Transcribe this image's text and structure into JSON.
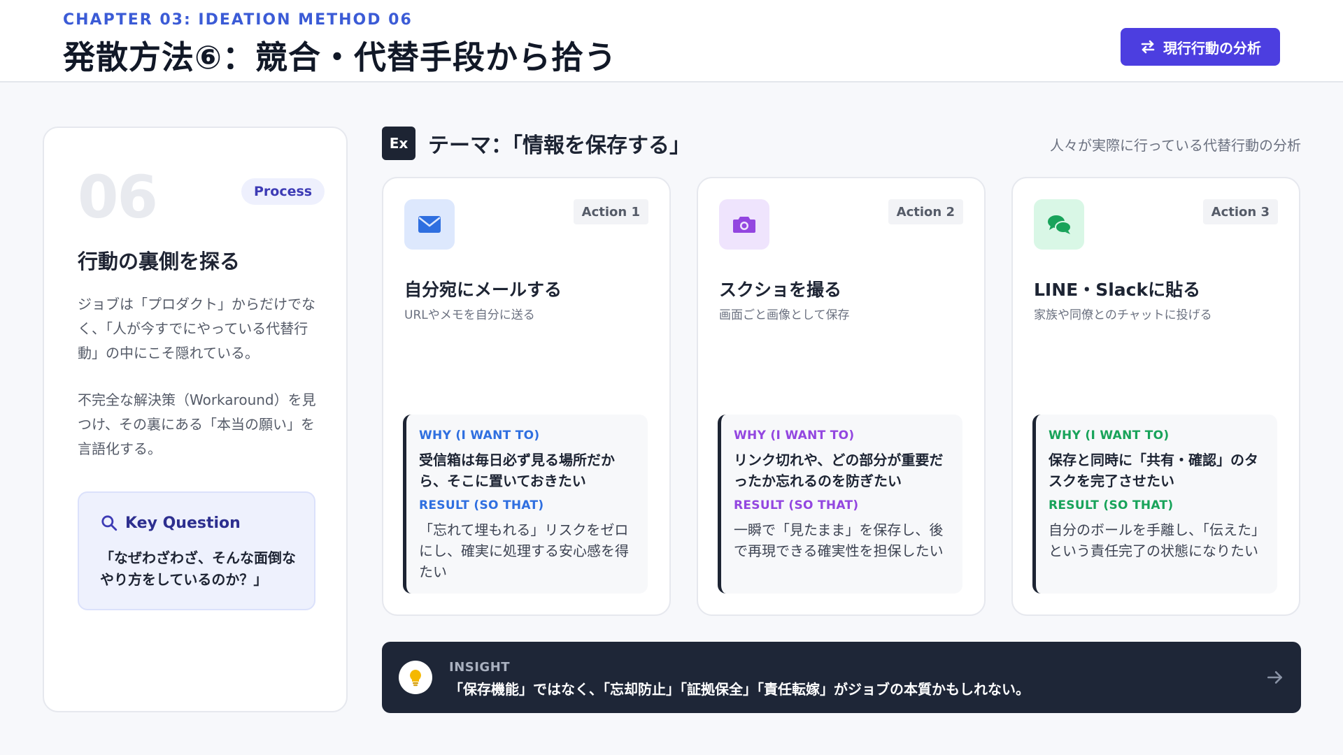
{
  "header": {
    "chapter": "CHAPTER 03: IDEATION METHOD 06",
    "title": "発散方法⑥：競合・代替手段から拾う",
    "button_label": "現行行動の分析",
    "button_icon": "swap-icon"
  },
  "left_panel": {
    "number": "06",
    "badge": "Process",
    "heading": "行動の裏側を探る",
    "paragraph1": "ジョブは「プロダクト」からだけでなく、「人が今すでにやっている代替行動」の中にこそ隠れている。",
    "paragraph2": "不完全な解決策（Workaround）を見つけ、その裏にある「本当の願い」を言語化する。",
    "key_question": {
      "title": "Key Question",
      "icon": "search-icon",
      "text": "「なぜわざわざ、そんな面倒なやり方をしているのか？」"
    }
  },
  "theme": {
    "badge": "Ex",
    "title": "テーマ：「情報を保存する」",
    "subtitle": "人々が実際に行っている代替行動の分析"
  },
  "cards": [
    {
      "tag": "Action 1",
      "icon": "envelope-icon",
      "accent": "#2f6fe0",
      "title": "自分宛にメールする",
      "subtitle": "URLやメモを自分に送る",
      "why_label": "WHY (I WANT TO)",
      "why_text": "受信箱は毎日必ず見る場所だから、そこに置いておきたい",
      "result_label": "RESULT (SO THAT)",
      "result_text": "「忘れて埋もれる」リスクをゼロにし、確実に処理する安心感を得たい"
    },
    {
      "tag": "Action 2",
      "icon": "camera-icon",
      "accent": "#9346e0",
      "title": "スクショを撮る",
      "subtitle": "画面ごと画像として保存",
      "why_label": "WHY (I WANT TO)",
      "why_text": "リンク切れや、どの部分が重要だったか忘れるのを防ぎたい",
      "result_label": "RESULT (SO THAT)",
      "result_text": "一瞬で「見たまま」を保存し、後で再現できる確実性を担保したい"
    },
    {
      "tag": "Action 3",
      "icon": "chat-bubbles-icon",
      "accent": "#18a35a",
      "title": "LINE・Slackに貼る",
      "subtitle": "家族や同僚とのチャットに投げる",
      "why_label": "WHY (I WANT TO)",
      "why_text": "保存と同時に「共有・確認」のタスクを完了させたい",
      "result_label": "RESULT (SO THAT)",
      "result_text": "自分のボールを手離し、「伝えた」という責任完了の状態になりたい"
    }
  ],
  "insight": {
    "label": "INSIGHT",
    "icon": "lightbulb-icon",
    "text": "「保存機能」ではなく、「忘却防止」「証拠保全」「責任転嫁」がジョブの本質かもしれない。",
    "arrow_icon": "arrow-right-icon"
  }
}
